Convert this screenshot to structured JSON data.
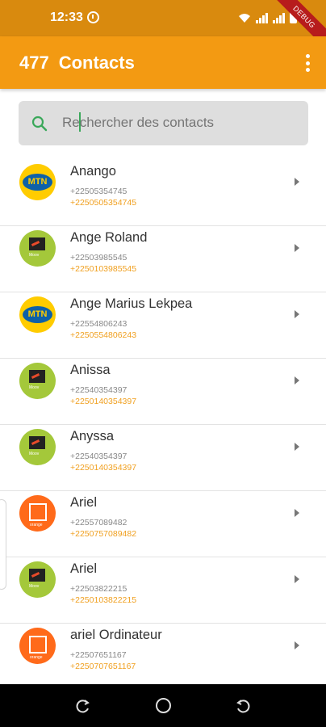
{
  "status_bar": {
    "time": "12:33",
    "debug_label": "DEBUG",
    "colors": {
      "background": "#d98a0e"
    }
  },
  "app_bar": {
    "count": "477",
    "title": "Contacts",
    "more_icon": "more-vert-icon",
    "colors": {
      "background": "#f39a12"
    }
  },
  "search": {
    "placeholder": "Rechercher des contacts",
    "value": "",
    "icon": "search-icon"
  },
  "contacts": [
    {
      "name": "Anango",
      "phone": "+22505354745",
      "phone_alt": "+2250505354745",
      "operator": "mtn"
    },
    {
      "name": "Ange Roland",
      "phone": "+22503985545",
      "phone_alt": "+2250103985545",
      "operator": "moov"
    },
    {
      "name": "Ange Marius Lekpea",
      "phone": "+22554806243",
      "phone_alt": "+2250554806243",
      "operator": "mtn"
    },
    {
      "name": "Anissa",
      "phone": "+22540354397",
      "phone_alt": "+2250140354397",
      "operator": "moov"
    },
    {
      "name": "Anyssa",
      "phone": "+22540354397",
      "phone_alt": "+2250140354397",
      "operator": "moov"
    },
    {
      "name": "Ariel",
      "phone": "+22557089482",
      "phone_alt": "+2250757089482",
      "operator": "orange"
    },
    {
      "name": "Ariel",
      "phone": "+22503822215",
      "phone_alt": "+2250103822215",
      "operator": "moov"
    },
    {
      "name": "ariel Ordinateur",
      "phone": "+22507651167",
      "phone_alt": "+2250707651167",
      "operator": "orange"
    }
  ],
  "operator_logos": {
    "mtn": {
      "text": "MTN",
      "color": "#ffcc00"
    },
    "moov": {
      "text": "Moov",
      "color": "#a4c83a"
    },
    "orange": {
      "text": "orange",
      "color": "#ff6a1a"
    }
  },
  "accent_colors": {
    "secondary_phone": "#f0a020"
  },
  "nav_bar": {
    "icons": [
      "recent-apps-icon",
      "home-icon",
      "back-icon"
    ]
  }
}
